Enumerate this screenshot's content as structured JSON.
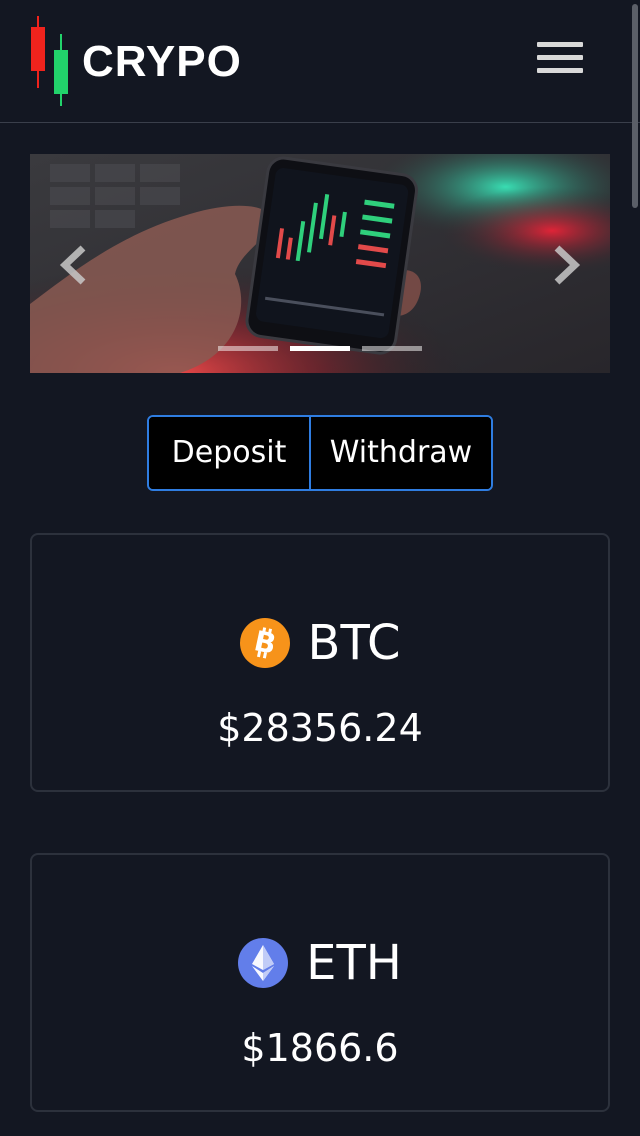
{
  "header": {
    "brand": "CRYPO",
    "logo_icon": "candlestick-logo-icon",
    "menu_icon": "hamburger-menu-icon"
  },
  "carousel": {
    "image_description_icon": "phone-trading-chart-photo",
    "prev_icon": "chevron-left-icon",
    "next_icon": "chevron-right-icon",
    "slide_count": 3,
    "active_index": 1
  },
  "actions": {
    "deposit_label": "Deposit",
    "withdraw_label": "Withdraw"
  },
  "coins": [
    {
      "symbol": "BTC",
      "price": "$28356.24",
      "icon": "bitcoin-icon",
      "color": "#f7931a"
    },
    {
      "symbol": "ETH",
      "price": "$1866.6",
      "icon": "ethereum-icon",
      "color": "#627eea"
    }
  ],
  "colors": {
    "background": "#131722",
    "accent": "#2f7de1",
    "logo_red": "#f0231d",
    "logo_green": "#22d36b"
  }
}
